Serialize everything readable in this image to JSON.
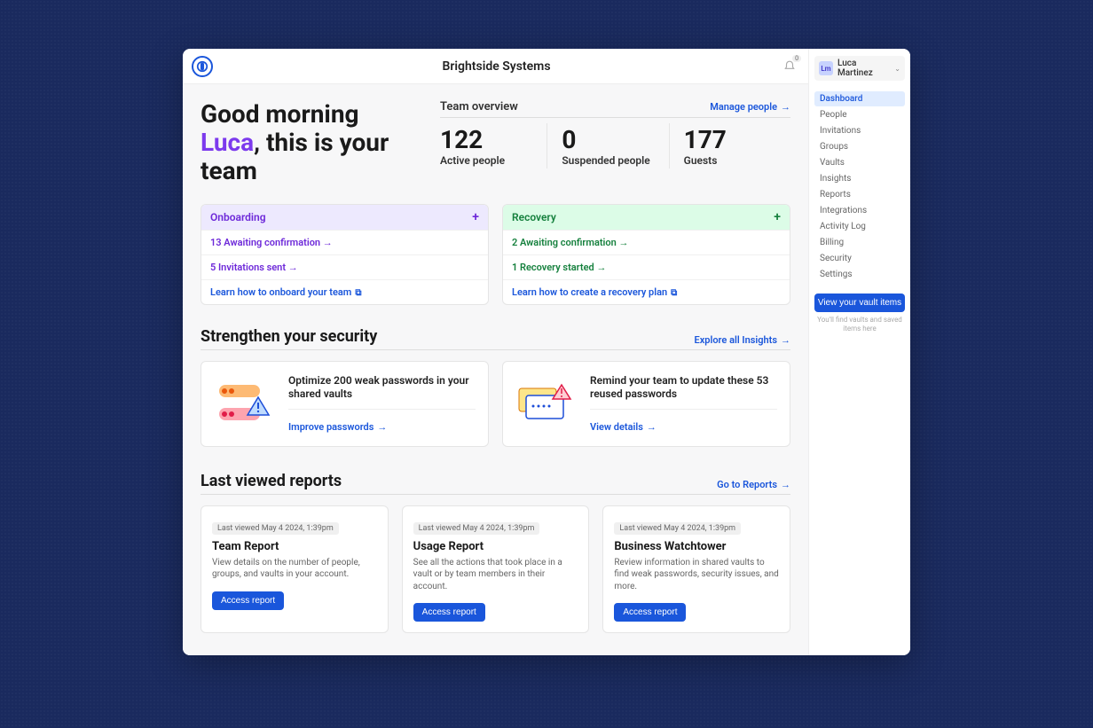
{
  "topbar": {
    "org_name": "Brightside Systems",
    "bell_count": "0"
  },
  "user": {
    "initials": "Lm",
    "name": "Luca Martinez"
  },
  "nav": {
    "items": [
      "Dashboard",
      "People",
      "Invitations",
      "Groups",
      "Vaults",
      "Insights",
      "Reports",
      "Integrations",
      "Activity Log",
      "Billing",
      "Security",
      "Settings"
    ],
    "active_index": 0,
    "vault_button": "View your vault items",
    "vault_hint": "You'll find vaults and saved items here"
  },
  "greeting": {
    "line1": "Good morning",
    "name": "Luca",
    "line2_after": ", this is your team"
  },
  "overview": {
    "title": "Team overview",
    "manage_link": "Manage people",
    "stats": [
      {
        "value": "122",
        "label": "Active people"
      },
      {
        "value": "0",
        "label": "Suspended people"
      },
      {
        "value": "177",
        "label": "Guests"
      }
    ]
  },
  "onboarding": {
    "title": "Onboarding",
    "rows": [
      "13 Awaiting confirmation",
      "5 Invitations sent"
    ],
    "learn": "Learn how to onboard your team"
  },
  "recovery": {
    "title": "Recovery",
    "rows": [
      "2 Awaiting confirmation",
      "1 Recovery started"
    ],
    "learn": "Learn how to create a recovery plan"
  },
  "security": {
    "title": "Strengthen your security",
    "explore_link": "Explore all Insights",
    "cards": [
      {
        "heading": "Optimize 200 weak passwords in your shared vaults",
        "action": "Improve passwords"
      },
      {
        "heading": "Remind your team to update these 53 reused passwords",
        "action": "View details"
      }
    ]
  },
  "reports": {
    "title": "Last viewed reports",
    "go_link": "Go to Reports",
    "items": [
      {
        "pill": "Last viewed May 4 2024, 1:39pm",
        "title": "Team Report",
        "desc": "View details on the number of people, groups, and vaults in your account.",
        "btn": "Access report"
      },
      {
        "pill": "Last viewed May 4 2024, 1:39pm",
        "title": "Usage Report",
        "desc": "See all the actions that took place in a vault or by team members in their account.",
        "btn": "Access report"
      },
      {
        "pill": "Last viewed May 4 2024, 1:39pm",
        "title": "Business Watchtower",
        "desc": "Review information in shared vaults to find weak passwords, security issues, and more.",
        "btn": "Access report"
      }
    ]
  }
}
